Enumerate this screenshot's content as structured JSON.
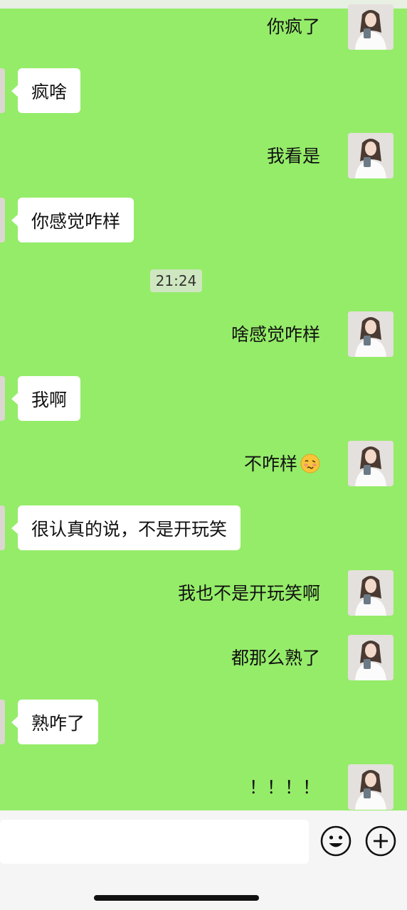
{
  "chat": {
    "messages": [
      {
        "side": "right",
        "text": "你疯了"
      },
      {
        "side": "left",
        "text": "疯啥"
      },
      {
        "side": "right",
        "text": "我看是"
      },
      {
        "side": "left",
        "text": "你感觉咋样"
      },
      {
        "side": "time",
        "text": "21:24"
      },
      {
        "side": "right",
        "text": "啥感觉咋样"
      },
      {
        "side": "left",
        "text": "我啊"
      },
      {
        "side": "right",
        "text": "不咋样",
        "emoji": "woozy-face-icon"
      },
      {
        "side": "left",
        "text": "很认真的说，不是开玩笑"
      },
      {
        "side": "right",
        "text": "我也不是开玩笑啊"
      },
      {
        "side": "right",
        "text": "都那么熟了"
      },
      {
        "side": "left",
        "text": "熟咋了"
      },
      {
        "side": "right",
        "text": "！！！！"
      }
    ]
  },
  "input": {
    "value": "",
    "placeholder": ""
  },
  "icons": {
    "emoji_button": "smiley-face-icon",
    "more_button": "plus-circle-icon"
  },
  "colors": {
    "chat_background": "#95ec69",
    "bubble_left": "#ffffff",
    "time_chip": "#cfe7c0",
    "bottom_bar": "#f5f5f5"
  }
}
